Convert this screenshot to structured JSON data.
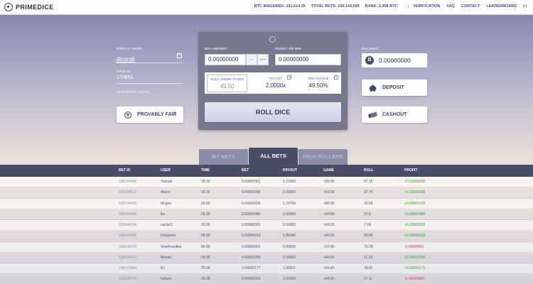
{
  "brand": "PRIMEDICE",
  "nav": {
    "btc_wagered": "BTC WAGERED: 331,614.25",
    "total_bets": "TOTAL BETS: 158,144,699",
    "bank": "BANK: 2,908 BTC",
    "links": [
      "VERIFICATION",
      "FAQ",
      "CONTACT",
      "LEADERBOARD",
      "LI"
    ]
  },
  "account": {
    "display_name_label": "DISPLAY NAME",
    "display_name": "diceroll",
    "user_id_label": "USER ID",
    "user_id": "170851",
    "password_label": "PASSWORD (SHOW)",
    "provably_fair": "PROVABLY FAIR"
  },
  "game": {
    "bet_amount_label": "BET AMOUNT",
    "bet_amount": "0.00000000",
    "half_label": "½x",
    "max_label": "MAX",
    "profit_label": "PROFIT ON WIN",
    "profit_value": "0.00000000",
    "roll_under_label": "ROLL UNDER TO WIN",
    "roll_under_value": "49.50",
    "payout_label": "PAYOUT",
    "payout_value": "2.0000x",
    "win_chance_label": "WIN CHANCE",
    "win_chance_value": "49.50%",
    "roll_button": "ROLL DICE"
  },
  "wallet": {
    "balance_label": "BALANCE",
    "balance": "0.00000000",
    "btc_symbol": "B",
    "deposit": "DEPOSIT",
    "cashout": "CASHOUT"
  },
  "tabs": [
    "MY BETS",
    "ALL BETS",
    "HIGH ROLLERS"
  ],
  "active_tab": "ALL BETS",
  "table": {
    "headers": [
      "BET ID",
      "USER",
      "TIME",
      "BET",
      "PAYOUT",
      "GAME",
      "ROLL",
      "PROFIT"
    ],
    "rows": [
      {
        "id": "158144696",
        "user": "Tusnak",
        "time": "05:39",
        "bet": "0.00000001",
        "payout": "1.10000",
        "game": "<90.00",
        "roll": "67.16",
        "profit": "+0.00000000",
        "positive": true
      },
      {
        "id": "158144612",
        "user": "Allzee",
        "time": "05:39",
        "bet": "0.00000005",
        "payout": "2.00000",
        "game": "<49.50",
        "roll": "37.74",
        "profit": "+0.00000005",
        "positive": true
      },
      {
        "id": "158144520",
        "user": "Mcgee",
        "time": "05:39",
        "bet": "0.00000600",
        "payout": "1.23750",
        "game": "<80.00",
        "roll": "10.68",
        "profit": "+0.00001425",
        "positive": true
      },
      {
        "id": "158144446",
        "user": "ike",
        "time": "05:39",
        "bet": "0.00000080",
        "payout": "2.00000",
        "game": "<49.50",
        "roll": "37.8",
        "profit": "+0.00000080",
        "positive": true
      },
      {
        "id": "158144344",
        "user": "cache3",
        "time": "05:39",
        "bet": "0.00000002",
        "payout": "2.00000",
        "game": "<49.50",
        "roll": "7.18",
        "profit": "+0.00000002",
        "positive": true
      },
      {
        "id": "158144265",
        "user": "Dongwoo",
        "time": "05:39",
        "bet": "0.00000010",
        "payout": "1.96040",
        "game": "<49.50",
        "roll": "59.84",
        "profit": "+0.00000010",
        "positive": true
      },
      {
        "id": "158144174",
        "user": "VivaParadise",
        "time": "05:39",
        "bet": "0.00000001",
        "payout": "9.90000",
        "game": "<10.00",
        "roll": "75.78",
        "profit": "-0.00000001",
        "positive": false
      },
      {
        "id": "158144013",
        "user": "Monini",
        "time": "05:39",
        "bet": "0.00002000",
        "payout": "2.00000",
        "game": "<49.50",
        "roll": "11.33",
        "profit": "+0.00002000",
        "positive": true
      },
      {
        "id": "158143884",
        "user": "BJ",
        "time": "05:38",
        "bet": "0.00000177",
        "payout": "1.96001",
        "game": "<49.49",
        "roll": "78.83",
        "profit": "+0.00000170",
        "positive": true
      },
      {
        "id": "158143770",
        "user": "hollyes",
        "time": "05:38",
        "bet": "0.00000003",
        "payout": "2.00000",
        "game": "<49.50",
        "roll": "57.11",
        "profit": "-0.00000003",
        "positive": false
      }
    ]
  },
  "colors": {
    "header_dark": "#4a4d66",
    "panel": "#77798f",
    "profit_positive": "#3aa13a",
    "profit_negative": "#d23b3b"
  }
}
